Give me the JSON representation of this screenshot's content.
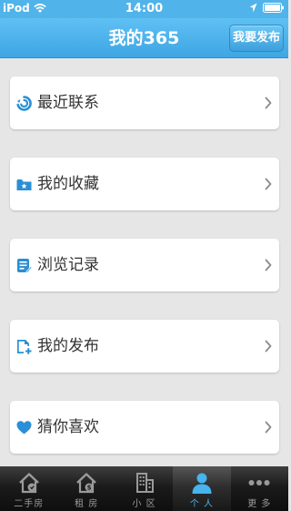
{
  "status_bar": {
    "carrier": "iPod",
    "time": "14:00",
    "icons": [
      "wifi-icon",
      "location-arrow-icon",
      "battery-icon"
    ]
  },
  "nav": {
    "title": "我的365",
    "publish_button": "我要发布"
  },
  "menu": [
    {
      "label": "最近联系",
      "icon": "recent-contact-icon"
    },
    {
      "label": "我的收藏",
      "icon": "favorites-folder-icon"
    },
    {
      "label": "浏览记录",
      "icon": "browse-history-icon"
    },
    {
      "label": "我的发布",
      "icon": "my-posts-icon"
    },
    {
      "label": "猜你喜欢",
      "icon": "heart-icon"
    }
  ],
  "tabs": [
    {
      "label": "二手房",
      "icon": "second-hand-house-icon"
    },
    {
      "label": "租 房",
      "icon": "rental-house-icon"
    },
    {
      "label": "小 区",
      "icon": "community-building-icon"
    },
    {
      "label": "个 人",
      "icon": "person-icon",
      "active": true
    },
    {
      "label": "更 多",
      "icon": "more-dots-icon"
    }
  ],
  "colors": {
    "accent": "#45b4ef",
    "navbar": "#4fb3ea",
    "page_background": "#e6e6e6",
    "tabbar": "#1b1b1b"
  }
}
